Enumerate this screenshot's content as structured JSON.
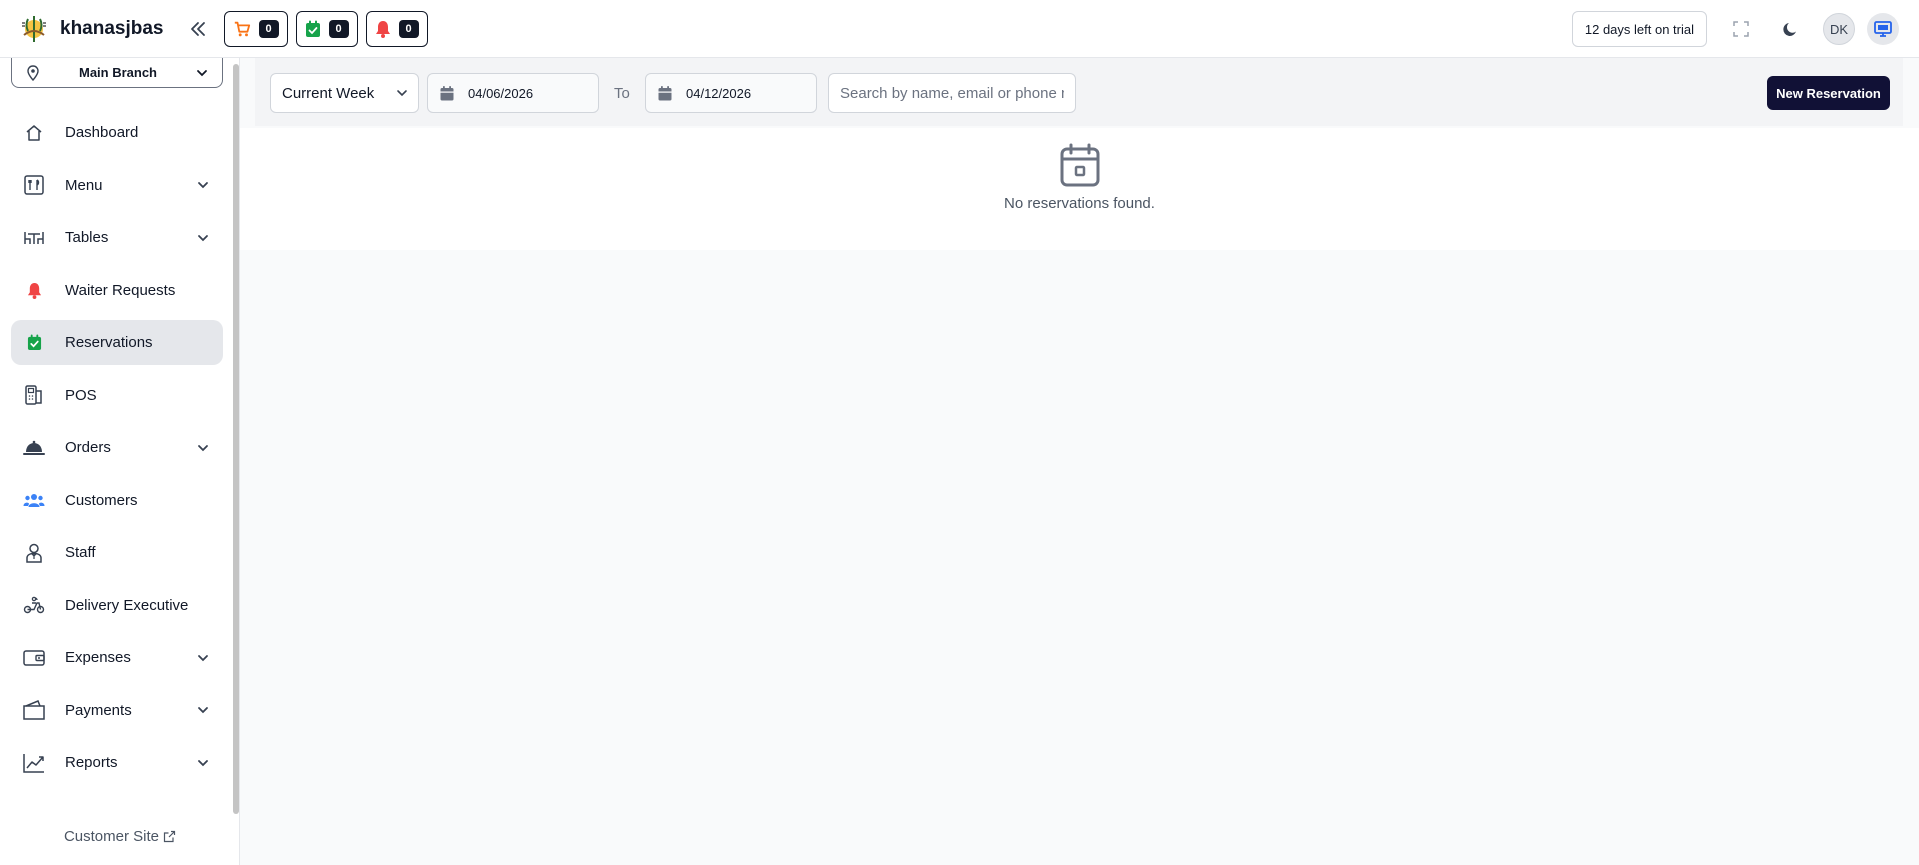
{
  "app": {
    "brand": "khanasjbas"
  },
  "header": {
    "counters": [
      {
        "name": "cart",
        "icon": "cart-icon",
        "count": "0",
        "color": "#f97316"
      },
      {
        "name": "reservations",
        "icon": "calendar-check-icon",
        "count": "0",
        "color": "#16a34a"
      },
      {
        "name": "waiter-requests",
        "icon": "bell-icon",
        "count": "0",
        "color": "#ef4444"
      }
    ],
    "trial_text": "12 days left on trial",
    "avatar_initials": "DK"
  },
  "sidebar": {
    "branch": "Main Branch",
    "items": [
      {
        "label": "Dashboard",
        "icon": "home-icon",
        "has_children": false,
        "active": false
      },
      {
        "label": "Menu",
        "icon": "menu-icon",
        "has_children": true,
        "active": false
      },
      {
        "label": "Tables",
        "icon": "table-icon",
        "has_children": true,
        "active": false
      },
      {
        "label": "Waiter Requests",
        "icon": "bell-icon",
        "has_children": false,
        "active": false
      },
      {
        "label": "Reservations",
        "icon": "calendar-check-icon",
        "has_children": false,
        "active": true
      },
      {
        "label": "POS",
        "icon": "pos-icon",
        "has_children": false,
        "active": false
      },
      {
        "label": "Orders",
        "icon": "service-bell-icon",
        "has_children": true,
        "active": false
      },
      {
        "label": "Customers",
        "icon": "users-icon",
        "has_children": false,
        "active": false
      },
      {
        "label": "Staff",
        "icon": "staff-icon",
        "has_children": false,
        "active": false
      },
      {
        "label": "Delivery Executive",
        "icon": "scooter-icon",
        "has_children": false,
        "active": false
      },
      {
        "label": "Expenses",
        "icon": "wallet-icon",
        "has_children": true,
        "active": false
      },
      {
        "label": "Payments",
        "icon": "payments-icon",
        "has_children": true,
        "active": false
      },
      {
        "label": "Reports",
        "icon": "chart-icon",
        "has_children": true,
        "active": false
      }
    ],
    "customer_site": "Customer Site"
  },
  "filters": {
    "period": "Current Week",
    "start_date": "04/06/2026",
    "to_label": "To",
    "end_date": "04/12/2026",
    "search_placeholder": "Search by name, email or phone n",
    "new_button": "New Reservation"
  },
  "empty_state": {
    "message": "No reservations found.",
    "icon": "calendar-icon"
  },
  "colors": {
    "accent": "#111136",
    "active_bg": "#e5e7eb",
    "icon_gray": "#6b7280"
  }
}
